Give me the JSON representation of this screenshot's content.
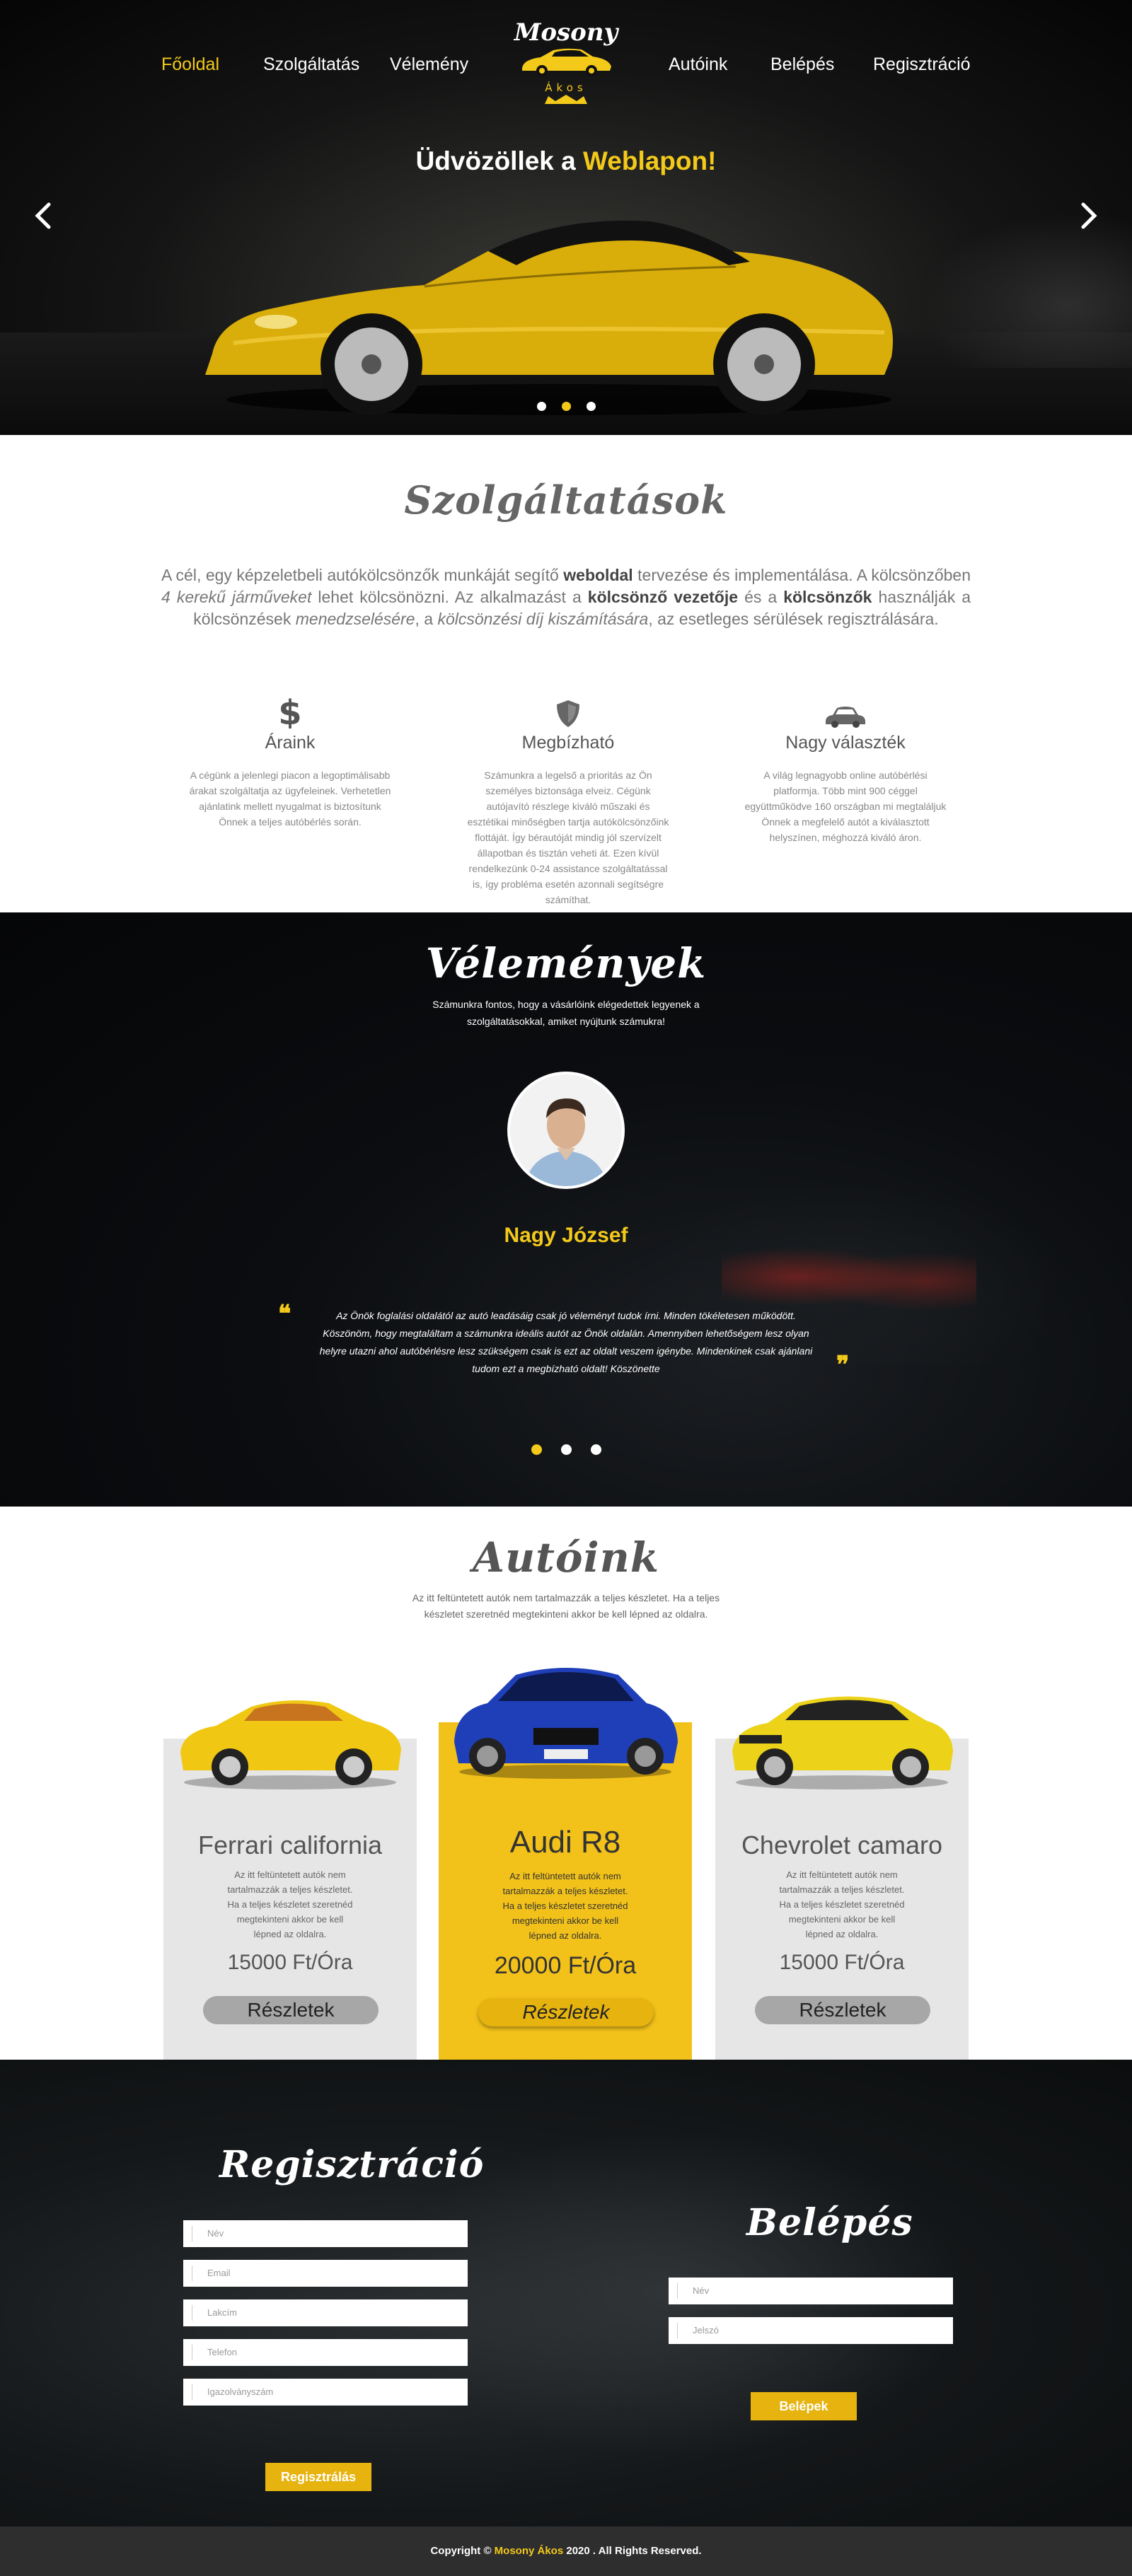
{
  "nav": {
    "items": [
      "Főoldal",
      "Szolgáltatás",
      "Vélemény",
      "Autóink",
      "Belépés",
      "Regisztráció"
    ],
    "active": "Főoldal"
  },
  "logo": {
    "name": "Mosony",
    "sub": "Ákos"
  },
  "hero": {
    "title_pre": "Üdvözöllek a ",
    "title_hl": "Weblapon!"
  },
  "services": {
    "title": "Szolgáltatások",
    "intro": {
      "p1": "A cél, egy képzeletbeli autókölcsönzők munkáját segítő ",
      "b1": "weboldal",
      "p2": " tervezése és implementálása. A kölcsönzőben ",
      "i1": "4 kerekű járműveket",
      "p3": " lehet kölcsönözni. Az alkalmazást a ",
      "b2": "kölcsönző vezetője",
      "p4": " és a ",
      "b3": "kölcsönzők",
      "p5": " használják a kölcsönzések ",
      "i2": "menedzselésére",
      "p6": ", a ",
      "i3": "kölcsönzési díj kiszámítására",
      "p7": ", az esetleges sérülések regisztrálására."
    },
    "features": [
      {
        "icon": "dollar-icon",
        "title": "Áraink",
        "text": "A cégünk a jelenlegi piacon a legoptimálisabb árakat szolgáltatja az ügyfeleinek. Verhetetlen ajánlatink mellett nyugalmat is biztosítunk Önnek a teljes autóbérlés során."
      },
      {
        "icon": "shield-icon",
        "title": "Megbízható",
        "text": "Számunkra a legelső a prioritás az Ön személyes biztonsága elveiz. Cégünk autójavító részlege kiváló műszaki és esztétikai minőségben tartja autókölcsönzőink flottáját. Így bérautóját mindig jól szervízelt állapotban és tisztán veheti át. Ezen kívül rendelkezünk 0-24 assistance szolgáltatással is, így probléma esetén azonnali segítségre számíthat."
      },
      {
        "icon": "car-icon",
        "title": "Nagy választék",
        "text": "A világ legnagyobb online autóbérlési platformja. Több mint 900 céggel együttműködve 160 országban mi megtaláljuk Önnek a megfelelő autót a kiválasztott helyszínen, méghozzá kiváló áron."
      }
    ]
  },
  "reviews": {
    "title": "Vélemények",
    "subtitle": "Számunkra fontos, hogy a vásárlóink elégedettek legyenek a szolgáltatásokkal, amiket nyújtunk számukra!",
    "name": "Nagy József",
    "text": "Az Önök foglalási oldalától az autó leadásáig csak jó véleményt tudok írni. Minden tökéletesen működött. Köszönöm, hogy megtaláltam a számunkra ideális autót az Önök oldalán. Amennyiben lehetőségem lesz olyan helyre utazni ahol autóbérlésre lesz szükségem csak is ezt az oldalt veszem igénybe. Mindenkinek csak ajánlani tudom ezt a megbízható oldalt! Köszönette",
    "active_index": 0
  },
  "cars": {
    "title": "Autóink",
    "subtitle": "Az itt feltüntetett autók nem tartalmazzák a teljes készletet. Ha a teljes készletet szeretnéd megtekinteni akkor be kell lépned az oldalra.",
    "items": [
      {
        "name": "Ferrari california",
        "desc": "Az itt feltüntetett autók nem tartalmazzák a teljes készletet. Ha a teljes készletet szeretnéd megtekinteni akkor be kell lépned az oldalra.",
        "price": "15000 Ft/Óra",
        "button": "Részletek",
        "color": "#f0c814"
      },
      {
        "name": "Audi R8",
        "desc": "Az itt feltüntetett autók nem tartalmazzák a teljes készletet. Ha a teljes készletet szeretnéd megtekinteni akkor be kell lépned az oldalra.",
        "price": "20000 Ft/Óra",
        "button": "Részletek",
        "color": "#1f3fb8"
      },
      {
        "name": "Chevrolet camaro",
        "desc": "Az itt feltüntetett autók nem tartalmazzák a teljes készletet. Ha a teljes készletet szeretnéd megtekinteni akkor be kell lépned az oldalra.",
        "price": "15000 Ft/Óra",
        "button": "Részletek",
        "color": "#ecd31a"
      }
    ]
  },
  "register": {
    "title": "Regisztráció",
    "fields": [
      "Név",
      "Email",
      "Lakcím",
      "Telefon",
      "Igazolványszám"
    ],
    "button": "Regisztrálás"
  },
  "login": {
    "title": "Belépés",
    "fields": [
      "Név",
      "Jelszó"
    ],
    "button": "Belépek"
  },
  "footer": {
    "pre": "Copyright © ",
    "hl": "Mosony Ákos",
    "post": " 2020 . All Rights Reserved."
  },
  "colors": {
    "accent": "#f3c91a",
    "dark": "#0b0d10",
    "card_grey": "#e6e6e6",
    "card_yellow": "#f3c21a"
  }
}
